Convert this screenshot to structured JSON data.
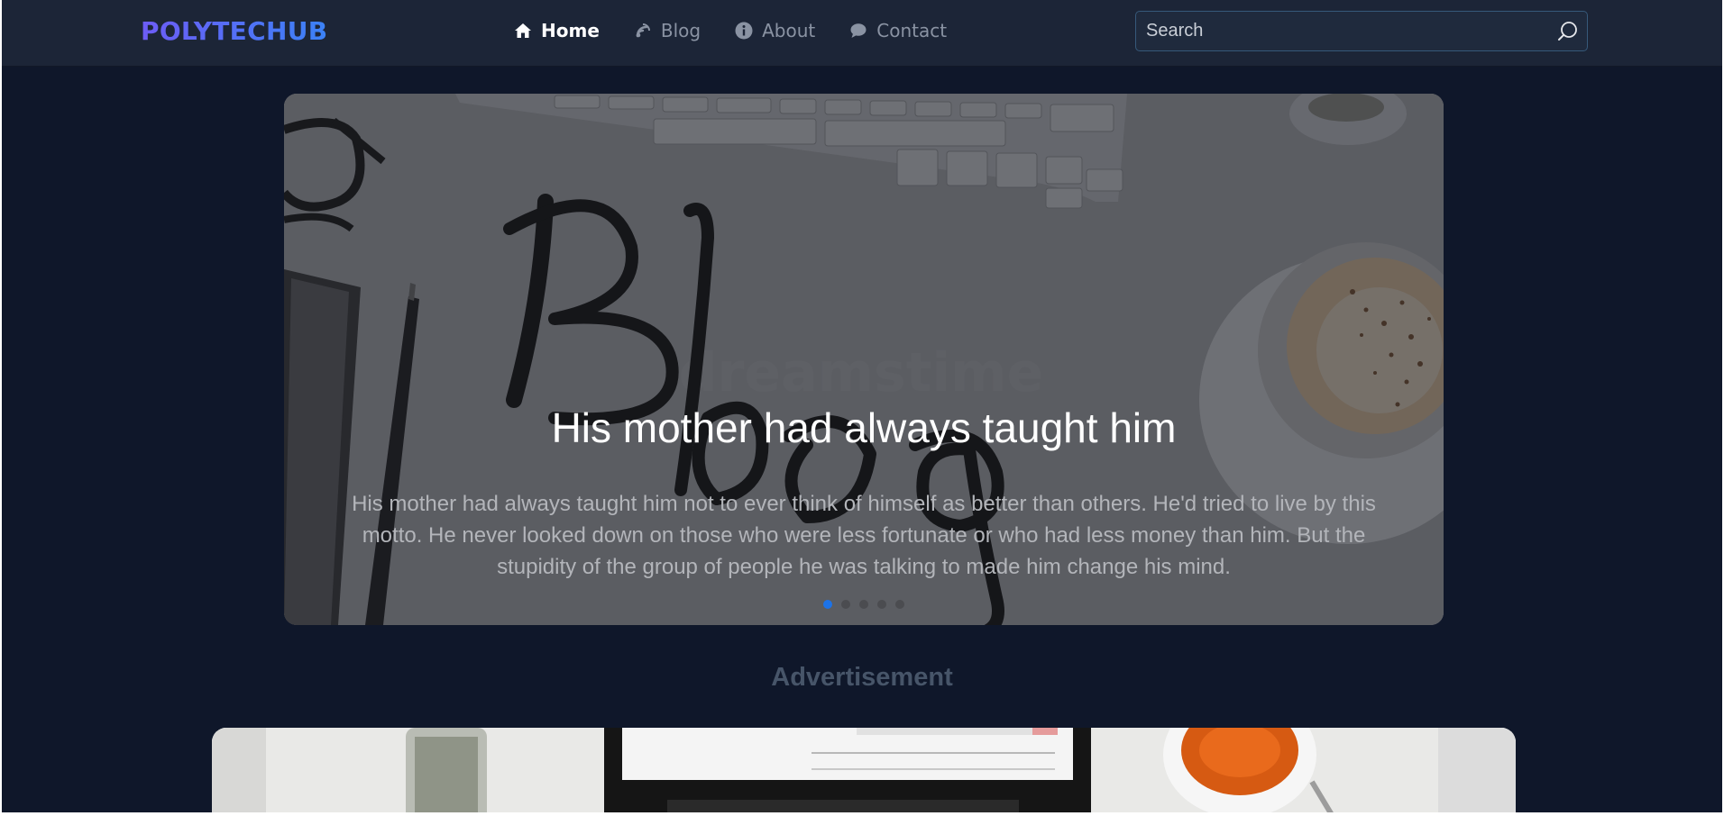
{
  "brand": {
    "name": "POLYTECHUB"
  },
  "nav": {
    "items": [
      {
        "label": "Home",
        "icon": "home-icon",
        "active": true
      },
      {
        "label": "Blog",
        "icon": "blog-icon",
        "active": false
      },
      {
        "label": "About",
        "icon": "info-icon",
        "active": false
      },
      {
        "label": "Contact",
        "icon": "chat-icon",
        "active": false
      }
    ]
  },
  "search": {
    "placeholder": "Search",
    "icon": "search-icon"
  },
  "carousel": {
    "slide_title": "His mother had always taught him",
    "slide_text": "His mother had always taught him not to ever think of himself as better than others. He'd tried to live by this motto. He never looked down on those who were less fortunate or who had less money than him. But the stupidity of the group of people he was talking to made him change his mind.",
    "background_lettering": "Blog",
    "slide_count": 5,
    "active_slide": 1
  },
  "advertisement": {
    "heading": "Advertisement"
  },
  "colors": {
    "page_bg": "#0f172a",
    "navbar_bg": "#1c2537",
    "brand_gradient_start": "#6d5cf6",
    "brand_gradient_end": "#3b82f6",
    "active_indicator": "#1d73e8",
    "ad_heading": "#475569"
  }
}
